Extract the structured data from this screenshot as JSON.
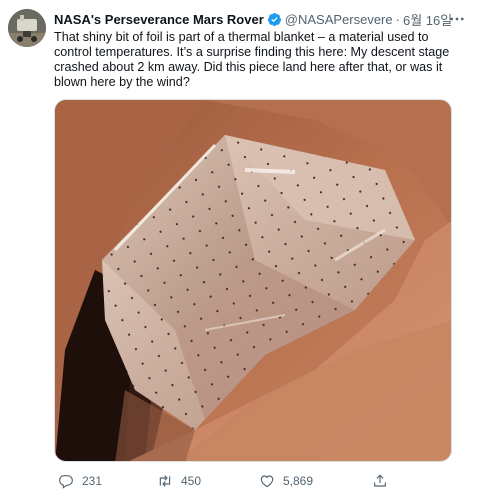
{
  "tweet": {
    "author_name": "NASA's Perseverance Mars Rover",
    "handle": "@NASAPersevere",
    "separator": "·",
    "date": "6월 16일",
    "text": "That shiny bit of foil is part of a thermal blanket – a material used to control temperatures. It’s a surprise finding this here: My descent stage crashed about 2 km away. Did this piece land here after that, or was it blown here by the wind?"
  },
  "actions": {
    "replies": "231",
    "retweets": "450",
    "likes": "5,869"
  },
  "icons": {
    "verified": "verified-badge-icon",
    "more": "more-icon",
    "reply": "reply-icon",
    "retweet": "retweet-icon",
    "like": "heart-icon",
    "share": "share-icon"
  },
  "colors": {
    "verified": "#1d9bf0",
    "secondary_text": "#536471",
    "primary_text": "#0f1419"
  }
}
